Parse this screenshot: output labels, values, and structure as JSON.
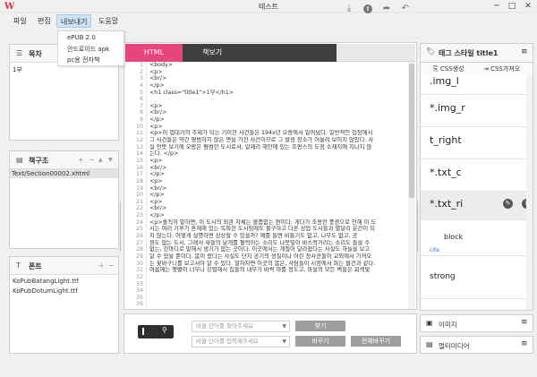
{
  "window": {
    "title": "테스트",
    "controls": [
      "─",
      "□",
      "✕"
    ]
  },
  "menu": {
    "items": [
      "파일",
      "편집",
      "내보내기",
      "도움말"
    ],
    "dropdown": [
      "ePUB 2.0",
      "안드로이드 apk",
      "pc용 전자책"
    ]
  },
  "left": {
    "toc": {
      "title": "목차",
      "items": [
        "1부"
      ]
    },
    "book": {
      "title": "책구조",
      "items": [
        "Text/Section00002.xhtml"
      ]
    },
    "fonts": {
      "title": "폰트",
      "items": [
        "KoPubBatangLight.ttf",
        "KoPubDotumLight.ttf"
      ]
    }
  },
  "editor": {
    "tab_html": "HTML",
    "tab_view": "책보기",
    "line_numbers": [
      "1",
      "2",
      "3",
      "4",
      "5",
      "6",
      "7",
      "8",
      "9",
      "10",
      "11",
      "12",
      "13",
      "14",
      "15",
      "16",
      "17",
      "18",
      "19",
      "20",
      "21",
      "22",
      "23",
      "24",
      "25",
      "26",
      "27",
      "28",
      "29",
      "30",
      "31",
      "32",
      "33",
      "34",
      "35",
      "36"
    ],
    "lines": [
      "<body>",
      "  <p>",
      "    <br/>",
      "  </p>",
      "  <h1 class=\"title1\">1부</h1>",
      "",
      "  <p>",
      "    <br/>",
      "  </p>",
      "  <p>",
      "  <p>이 엽대기의 주제가 되는 기이한 사건들은 194x년 오랑에서 일어났다. 일반적인 입장에서",
      "  그 사건들은 약간 평범하지 않은 면을 가진 사건이므로 그 발생 장소가 어울려 보이지 않았다. 사",
      "  실 언뜻 보기에 오랑은 평범한 도시로서, 알제리 해안에 있는 프랑스의 도청 소재지에 지나지 않",
      "  는다. </p>",
      "  <p>",
      "    <br/>",
      "  </p>",
      "  <p>",
      "    <br/>",
      "  </p>",
      "  <p>",
      "    <br/>",
      "  </p>",
      "  <p>솔직히 말하면, 이 도시의 외관 자체는 볼품없는 편이다. 게다가 조용한 풍광으로 인해 이 도",
      "  시는 여러 기후가 혼재해 있는 독특한 도시임에도 불구하고 다른 상업 도시들과 별달리 분간이 되",
      "  지 않는다. 어떻게 설명하면 상상할 수 있을까? 예를 들면 비둘기도 없고, 나무도 없고, 공",
      "  원도 없는 도시, 그래서 새들의 날개를 펄럭이는 소리도 나뭇잎이 바스락거리는 소리도 들을 수",
      "  없는, 한마디로 말해서 생기가 없는 곳이다. 이곳에서는 계절이 달라졌다는 사실도 하늘을 보고",
      "  알 수 있을 뿐이다. 봄이 왔다는 사실도 단지 공기의 성질이나 어린 장사꾼들이 교외에서 가져오",
      "  는 꽃바구니를 보고서야 알 수 있다. 말하자면 이곳의 봄은, 사람들이 시장에서 파는 물건과 같다.",
      "  여름에는 햇볕이 너무나 강렬해서 집들의 내부가 바싹 마를 정도고, 마을의 모든 벽들은 회색빛",
      "",
      "",
      "",
      "",
      ""
    ]
  },
  "search": {
    "find_placeholder": "바꿀 단어를 찾아주세요",
    "replace_placeholder": "바꿀 단어를 입력해주세요",
    "find_button": "찾기",
    "replace_button": "바꾸기",
    "replace_all_button": "전체바꾸기"
  },
  "right": {
    "tag_style_title": "태그 스타일 title1",
    "css_create": "CSS생성",
    "css_import": "CSS가져오",
    "tags": [
      ".img_l",
      "*.img_r",
      "t_right",
      "*.txt_c",
      "*.txt_ri",
      "block",
      "cite",
      "strong",
      "",
      ""
    ],
    "image_title": "이미지",
    "media_title": "멀티미디어"
  },
  "colors": {
    "accent": "#e8457b",
    "dark_tab": "#3f3f3f",
    "menu_active": "#cde3f7"
  }
}
